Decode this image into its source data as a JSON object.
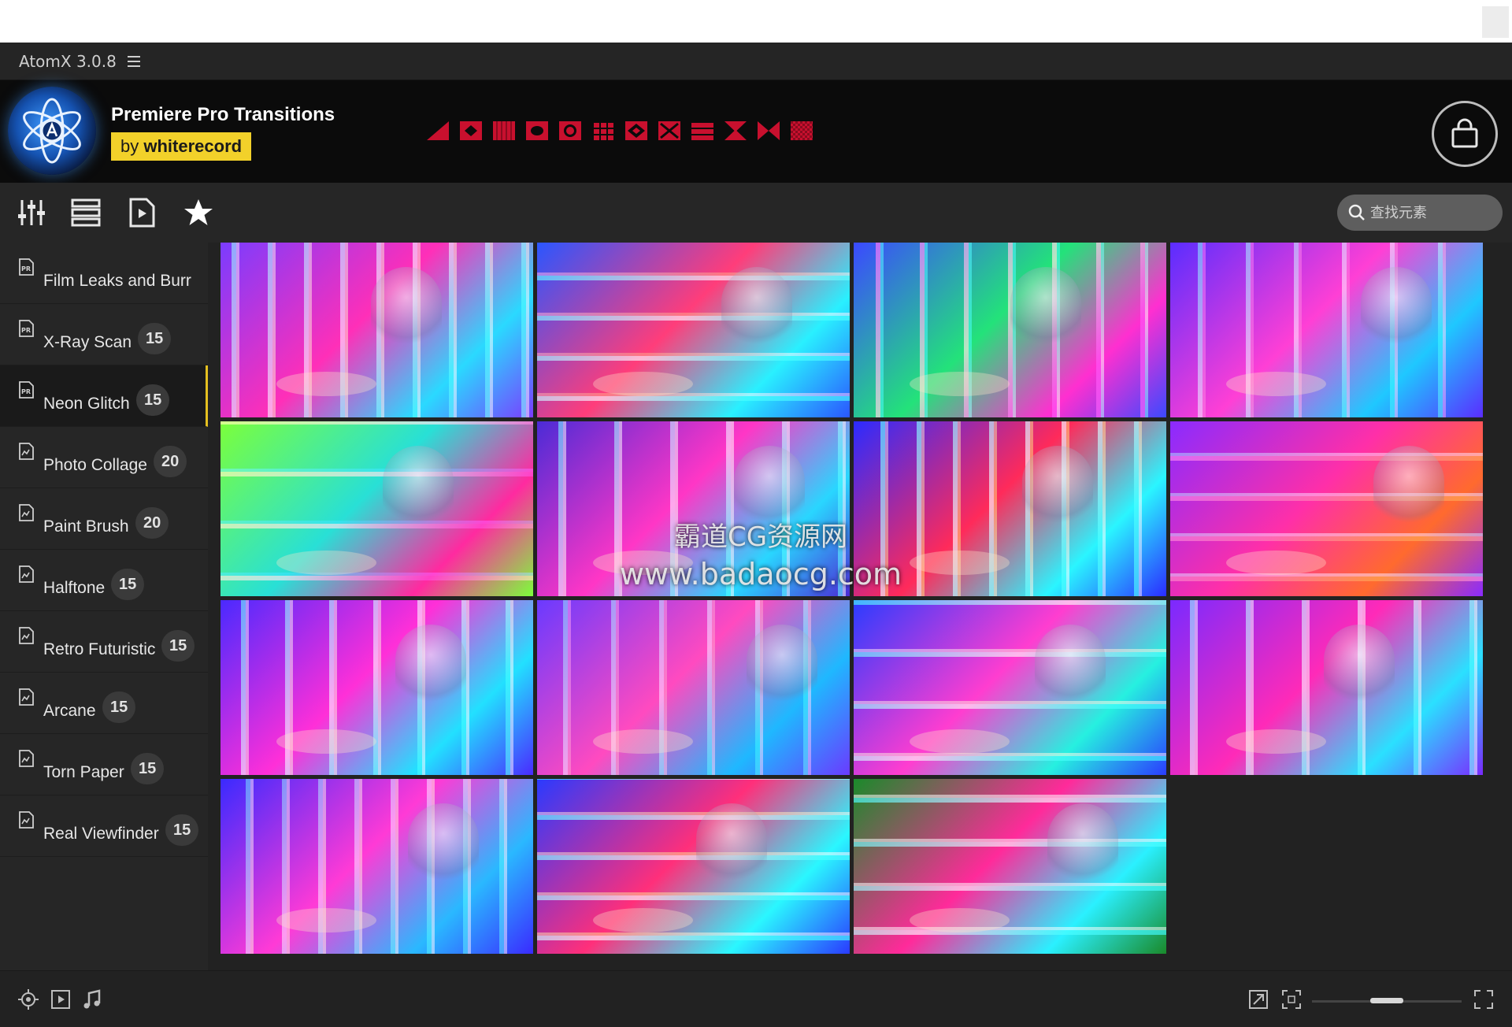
{
  "app": {
    "title": "AtomX 3.0.8"
  },
  "header": {
    "pack_title": "Premiere Pro Transitions",
    "by_prefix": "by",
    "author": "whiterecord",
    "accent_color": "#f2d12a",
    "transition_icon_color": "#c8102e"
  },
  "toolbar": {
    "icons": [
      "sliders-icon",
      "list-icon",
      "media-file-icon",
      "star-icon"
    ],
    "search_placeholder": "查找元素"
  },
  "sidebar": {
    "items": [
      {
        "label": "Film Leaks and Burr",
        "count": "",
        "active": false
      },
      {
        "label": "X-Ray Scan",
        "count": "15",
        "active": false
      },
      {
        "label": "Neon Glitch",
        "count": "15",
        "active": true
      },
      {
        "label": "Photo Collage",
        "count": "20",
        "active": false
      },
      {
        "label": "Paint Brush",
        "count": "20",
        "active": false
      },
      {
        "label": "Halftone",
        "count": "15",
        "active": false
      },
      {
        "label": "Retro Futuristic",
        "count": "15",
        "active": false
      },
      {
        "label": "Arcane",
        "count": "15",
        "active": false
      },
      {
        "label": "Torn Paper",
        "count": "15",
        "active": false
      },
      {
        "label": "Real Viewfinder",
        "count": "15",
        "active": false
      }
    ]
  },
  "watermark": {
    "line1": "霸道CG资源网",
    "line2": "www.badaocg.com"
  },
  "bottombar": {
    "icons": [
      "target-icon",
      "play-icon",
      "music-note-icon",
      "export-icon",
      "crop-icon",
      "fullscreen-icon"
    ],
    "zoom_level": 0.5
  }
}
